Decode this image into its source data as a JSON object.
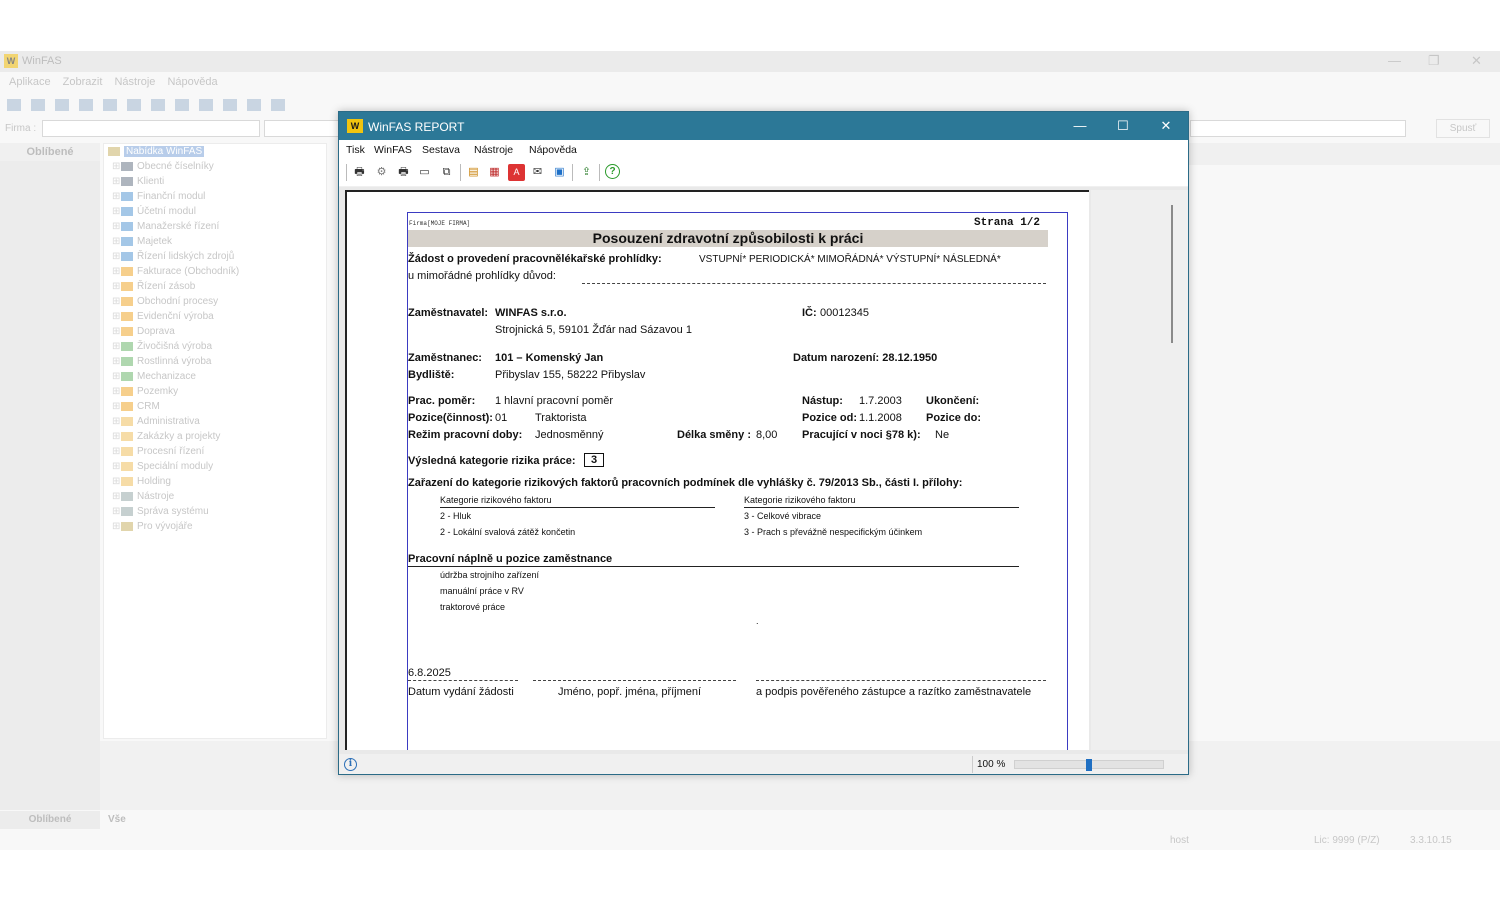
{
  "main": {
    "title": "WinFAS",
    "menu": [
      "Aplikace",
      "Zobrazit",
      "Nástroje",
      "Nápověda"
    ],
    "firma_label": "Firma :",
    "run_button": "Spusť",
    "favorites_header": "Oblíbené",
    "tree": {
      "root": "Nabídka WinFAS",
      "items": [
        "Obecné číselníky",
        "Klienti",
        "Finanční modul",
        "Účetní modul",
        "Manažerské řízení",
        "Majetek",
        "Řízení lidských zdrojů",
        "Fakturace (Obchodník)",
        "Řízení zásob",
        "Obchodní procesy",
        "Evidenční výroba",
        "Doprava",
        "Živočišná výroba",
        "Rostlinná výroba",
        "Mechanizace",
        "Pozemky",
        "CRM",
        "Administrativa",
        "Zakázky a projekty",
        "Procesní řízení",
        "Speciální moduly",
        "Holding",
        "Nástroje",
        "Správa systému",
        "Pro vývojáře"
      ]
    },
    "bottom_tabs": [
      "Oblíbené",
      "Vše"
    ],
    "status": {
      "user": "host",
      "lic": "Lic: 9999 (P/Z)",
      "version": "3.3.10.15"
    }
  },
  "report": {
    "title": "WinFAS REPORT",
    "menu": [
      "Tisk",
      "WinFAS",
      "Sestava",
      "Nástroje",
      "Nápověda"
    ],
    "toolbar_icons": [
      "print-icon",
      "settings-icon",
      "printer-icon",
      "print-preview-icon",
      "copy-icon",
      "folder-icon",
      "excel-icon",
      "pdf-icon",
      "email-icon",
      "save-icon",
      "export-icon",
      "help-icon"
    ],
    "zoom": "100 %",
    "zoom_level": 0.5
  },
  "doc": {
    "firma": "Firma[MOJE FIRMA]",
    "strana": "Strana 1/2",
    "title": "Posouzení zdravotní způsobilosti k práci",
    "zadost_label": "Žádost o provedení pracovnělékařské prohlídky:",
    "zadost_options": "VSTUPNÍ*  PERIODICKÁ*  MIMOŘÁDNÁ*  VÝSTUPNÍ*  NÁSLEDNÁ*",
    "duvod_label": "u mimořádné prohlídky důvod:",
    "zamestnavatel_label": "Zaměstnavatel:",
    "zamestnavatel": "WINFAS s.r.o.",
    "zamestnavatel_adresa": "Strojnická 5, 59101 Žďár nad Sázavou 1",
    "ic_label": "IČ:",
    "ic": "00012345",
    "zamestnanec_label": "Zaměstnanec:",
    "zamestnanec": "101 – Komenský Jan",
    "datum_narozeni": "Datum narození: 28.12.1950",
    "bydliste_label": "Bydliště:",
    "bydliste": "Přibyslav 155, 58222 Přibyslav",
    "prac_pomer_label": "Prac. poměr:",
    "prac_pomer": "1 hlavní pracovní poměr",
    "nastup_label": "Nástup:",
    "nastup": "1.7.2003",
    "ukonceni_label": "Ukončení:",
    "pozice_label": "Pozice(činnost):",
    "pozice_kod": "01",
    "pozice": "Traktorista",
    "pozice_od_label": "Pozice od:",
    "pozice_od": "1.1.2008",
    "pozice_do_label": "Pozice do:",
    "rezim_label": "Režim pracovní doby:",
    "rezim": "Jednosměnný",
    "delka_label": "Délka směny :",
    "delka": "8,00",
    "noc_label": "Pracující v noci §78 k):",
    "noc": "Ne",
    "kategorie_label": "Výsledná kategorie rizika práce:",
    "kategorie": "3",
    "zarazeni": "Zařazení do kategorie rizikových faktorů pracovních podmínek dle vyhlášky č. 79/2013 Sb., části I. přílohy:",
    "faktor_header": "Kategorie rizikového faktoru",
    "faktory_left": [
      "2 - Hluk",
      "2 - Lokální svalová zátěž končetin"
    ],
    "faktory_right": [
      "3 - Celkové vibrace",
      "3 - Prach s převážně nespecifickým účinkem"
    ],
    "naplne_label": "Pracovní náplně u pozice zaměstnance",
    "naplne": [
      "údržba strojního zařízení",
      "manuální práce v RV",
      "traktorové práce"
    ],
    "datum": "6.8.2025",
    "dot": ".",
    "sig_datum": "Datum vydání žádosti",
    "sig_jmeno": "Jméno, popř. jména, příjmení",
    "sig_podpis": "a podpis pověřeného zástupce a razítko zaměstnavatele"
  }
}
